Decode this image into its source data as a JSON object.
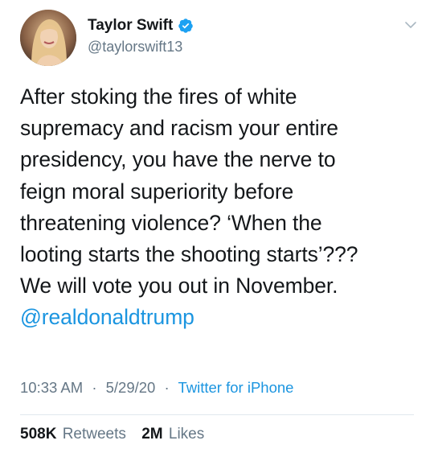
{
  "author": {
    "display_name": "Taylor Swift",
    "handle": "@taylorswift13",
    "verified": true
  },
  "tweet": {
    "lines": [
      "After stoking the fires of white",
      "supremacy and racism your entire",
      "presidency, you have the nerve to",
      "feign moral superiority before",
      "threatening violence? ‘When the",
      "looting starts the shooting starts’???",
      "We will vote you out in November."
    ],
    "mention": "@realdonaldtrump"
  },
  "meta": {
    "time": "10:33 AM",
    "date": "5/29/20",
    "separator": "·",
    "source": "Twitter for iPhone"
  },
  "stats": {
    "retweets_count": "508K",
    "retweets_label": "Retweets",
    "likes_count": "2M",
    "likes_label": "Likes"
  },
  "colors": {
    "link": "#1b95e0",
    "secondary_text": "#657786",
    "primary_text": "#14171a",
    "verified_badge": "#1da1f2",
    "divider": "#e1e8ed"
  },
  "icons": {
    "verified": "verified-badge-icon",
    "menu": "chevron-down-icon"
  }
}
